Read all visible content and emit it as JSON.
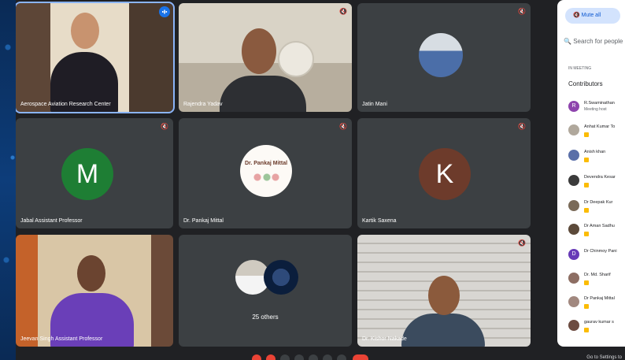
{
  "tiles": [
    {
      "name": "Aerospace Aviation Research Center",
      "mic": "speaking"
    },
    {
      "name": "Rajendra Yadav"
    },
    {
      "name": "Jatin Mani"
    },
    {
      "name": "Jabal Assistant Professor",
      "initial": "M",
      "color": "#1e7e34"
    },
    {
      "name": "Dr. Pankaj Mittal",
      "logo_text": "Dr. Pankaj Mittal"
    },
    {
      "name": "Kartik Saxena",
      "initial": "K",
      "color": "#6d3b2b"
    },
    {
      "name": "Jeevan Singh Assistant Professor"
    },
    {
      "others_label": "25 others"
    },
    {
      "name": "Dr. Kishor Nakade"
    }
  ],
  "panel": {
    "mute_all": "Mute all",
    "search_placeholder": "Search for people",
    "section": "In meeting",
    "contributors": "Contributors",
    "participants": [
      {
        "name": "R.Swaminathan",
        "sub": "Meeting host",
        "initial": "R",
        "color": "#8e44ad"
      },
      {
        "name": "Anhat Kumar To",
        "initial": "",
        "color": "#b0a89c",
        "badge": true
      },
      {
        "name": "Anish khan",
        "initial": "",
        "color": "#5a6fa8",
        "badge": true
      },
      {
        "name": "Devendra Kesar",
        "initial": "",
        "color": "#3b3b3b",
        "badge": true
      },
      {
        "name": "Dr Deepak Kur",
        "initial": "",
        "color": "#7a6a58",
        "badge": true
      },
      {
        "name": "Dr Aman Sadhu",
        "initial": "",
        "color": "#5c4a3a",
        "badge": true
      },
      {
        "name": "Dr Chinmoy Pani",
        "initial": "D",
        "color": "#673ab7"
      },
      {
        "name": "Dr. Md. Sharif",
        "initial": "",
        "color": "#8d6e63",
        "badge": true
      },
      {
        "name": "Dr Pankaj Mittal",
        "initial": "",
        "color": "#a1887f",
        "badge": true
      },
      {
        "name": "gaurav kumar s",
        "initial": "",
        "color": "#6d4c41",
        "badge": true
      }
    ],
    "hint": "Go to Settings to"
  },
  "icons": {
    "mic_off": "mic-off-icon",
    "speaking": "audio-indicator-icon"
  }
}
